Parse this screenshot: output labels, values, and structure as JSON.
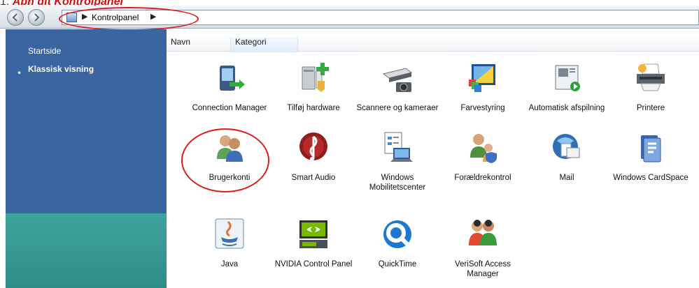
{
  "caption": {
    "number": "1.",
    "text": "Åbn dit Kontrolpanel"
  },
  "addressbar": {
    "breadcrumb_separator": "▶",
    "location": "Kontrolpanel",
    "back_icon": "back-arrow-icon",
    "forward_icon": "forward-arrow-icon",
    "folder_icon": "control-panel-icon"
  },
  "sidebar": {
    "items": [
      {
        "label": "Startside",
        "selected": false
      },
      {
        "label": "Klassisk visning",
        "selected": true
      }
    ],
    "bullet": "•"
  },
  "columns": [
    {
      "label": "Navn"
    },
    {
      "label": "Kategori"
    }
  ],
  "items": [
    {
      "label": "Connection Manager",
      "icon": "connection-manager-icon"
    },
    {
      "label": "Tilføj hardware",
      "icon": "add-hardware-icon"
    },
    {
      "label": "Scannere og kameraer",
      "icon": "scanner-camera-icon"
    },
    {
      "label": "Farvestyring",
      "icon": "color-management-icon"
    },
    {
      "label": "Automatisk afspilning",
      "icon": "autoplay-icon"
    },
    {
      "label": "Printere",
      "icon": "printer-icon"
    },
    {
      "label": "Brugerkonti",
      "icon": "user-accounts-icon"
    },
    {
      "label": "Smart Audio",
      "icon": "smart-audio-icon"
    },
    {
      "label": "Windows Mobilitetscenter",
      "icon": "mobility-center-icon"
    },
    {
      "label": "Forældrekontrol",
      "icon": "parental-controls-icon"
    },
    {
      "label": "Mail",
      "icon": "mail-icon"
    },
    {
      "label": "Windows CardSpace",
      "icon": "cardspace-icon"
    },
    {
      "label": "Java",
      "icon": "java-icon"
    },
    {
      "label": "NVIDIA Control Panel",
      "icon": "nvidia-icon"
    },
    {
      "label": "QuickTime",
      "icon": "quicktime-icon"
    },
    {
      "label": "VeriSoft Access Manager",
      "icon": "verisoft-icon"
    }
  ],
  "colors": {
    "annotation": "#dd1b1b",
    "sidebar_blue": "#3b65a0",
    "sidebar_teal": "#3fa39e"
  }
}
